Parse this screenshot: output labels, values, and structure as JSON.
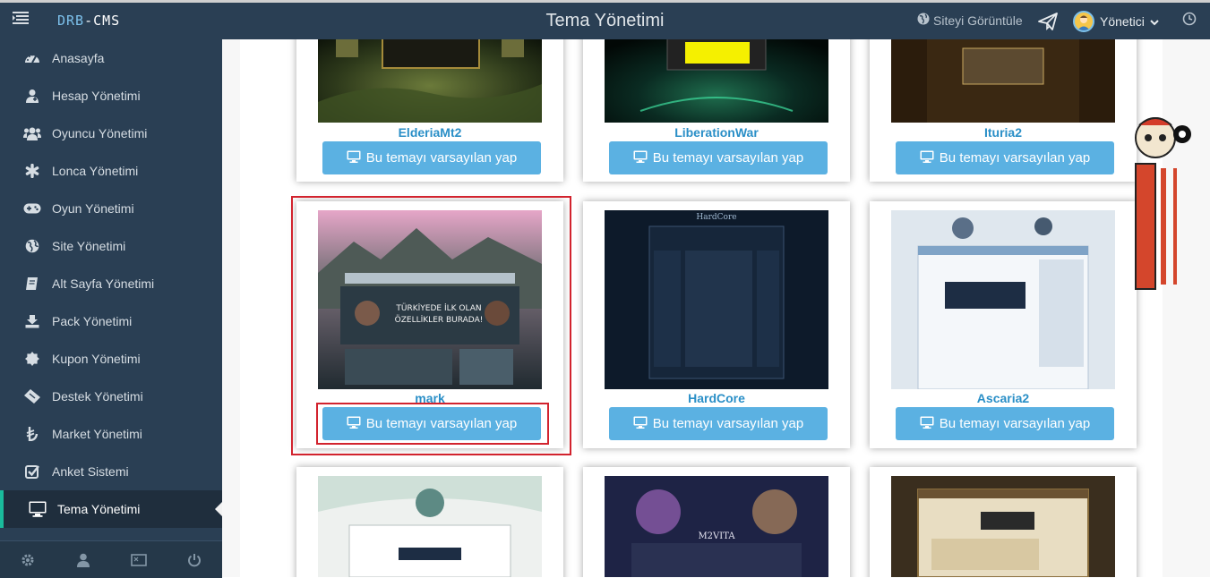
{
  "topbar": {
    "logo_part1": "DRB",
    "logo_sep": "-",
    "logo_part2": "CMS",
    "page_title": "Tema Yönetimi",
    "site_link": "Siteyi Görüntüle",
    "user_name": "Yönetici"
  },
  "sidebar": {
    "items": [
      {
        "label": "Anasayfa",
        "icon": "dashboard-icon"
      },
      {
        "label": "Hesap Yönetimi",
        "icon": "user-md-icon"
      },
      {
        "label": "Oyuncu Yönetimi",
        "icon": "users-icon"
      },
      {
        "label": "Lonca Yönetimi",
        "icon": "asterisk-icon"
      },
      {
        "label": "Oyun Yönetimi",
        "icon": "gamepad-icon"
      },
      {
        "label": "Site Yönetimi",
        "icon": "globe-icon"
      },
      {
        "label": "Alt Sayfa Yönetimi",
        "icon": "book-icon"
      },
      {
        "label": "Pack Yönetimi",
        "icon": "download-icon"
      },
      {
        "label": "Kupon Yönetimi",
        "icon": "certificate-icon"
      },
      {
        "label": "Destek Yönetimi",
        "icon": "ticket-icon"
      },
      {
        "label": "Market Yönetimi",
        "icon": "lira-icon"
      },
      {
        "label": "Anket Sistemi",
        "icon": "check-square-icon"
      },
      {
        "label": "Tema Yönetimi",
        "icon": "desktop-icon",
        "active": true
      }
    ],
    "footer_icons": [
      "settings-icon",
      "user-icon",
      "fullscreen-icon",
      "power-icon"
    ]
  },
  "themes": [
    {
      "name": "ElderiaMt2",
      "button": "Bu temayı varsayılan yap"
    },
    {
      "name": "LiberationWar",
      "button": "Bu temayı varsayılan yap"
    },
    {
      "name": "Ituria2",
      "button": "Bu temayı varsayılan yap"
    },
    {
      "name": "mark",
      "button": "Bu temayı varsayılan yap",
      "highlighted": true
    },
    {
      "name": "HardCore",
      "button": "Bu temayı varsayılan yap"
    },
    {
      "name": "Ascaria2",
      "button": "Bu temayı varsayılan yap"
    },
    {
      "name": "",
      "button": ""
    },
    {
      "name": "",
      "button": ""
    },
    {
      "name": "",
      "button": ""
    }
  ],
  "thumb_texts": {
    "mark_banner_line1": "TÜRKİYEDE İLK OLAN",
    "mark_banner_line2": "ÖZELLİKLER BURADA!",
    "hardcore_logo": "HardCore",
    "m2vita_logo": "M2VITA"
  },
  "colors": {
    "sidebar_bg": "#2a3f54",
    "accent": "#1abb9c",
    "button_bg": "#5bb1e2",
    "theme_name": "#2a8fc7",
    "highlight": "#d2232e"
  }
}
